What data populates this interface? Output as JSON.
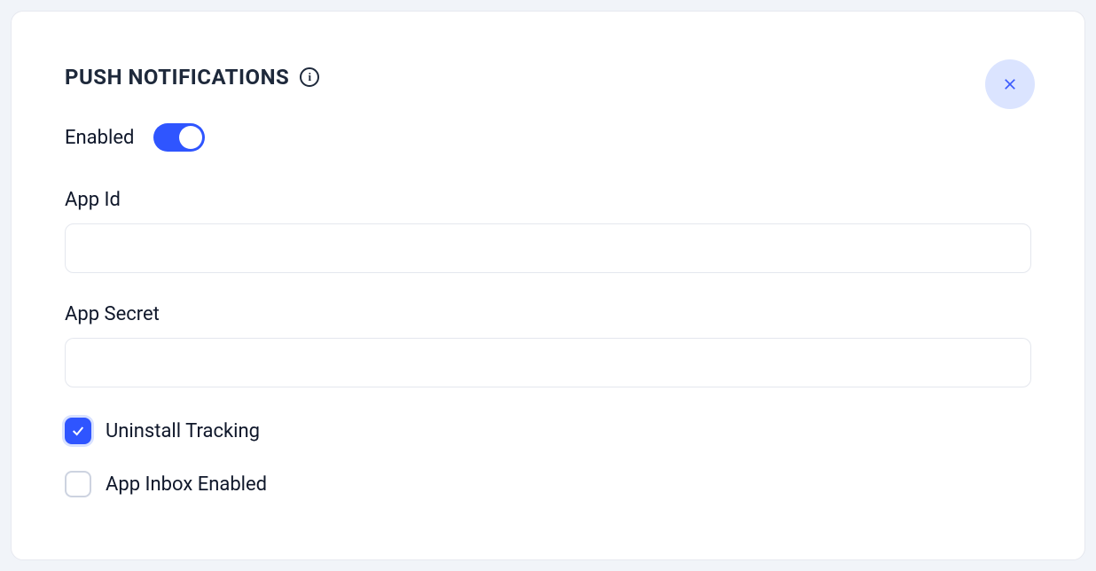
{
  "section": {
    "title": "PUSH NOTIFICATIONS"
  },
  "enabled": {
    "label": "Enabled",
    "value": true
  },
  "fields": {
    "appId": {
      "label": "App Id",
      "value": ""
    },
    "appSecret": {
      "label": "App Secret",
      "value": ""
    }
  },
  "options": {
    "uninstallTracking": {
      "label": "Uninstall Tracking",
      "checked": true
    },
    "appInboxEnabled": {
      "label": "App Inbox Enabled",
      "checked": false
    }
  }
}
